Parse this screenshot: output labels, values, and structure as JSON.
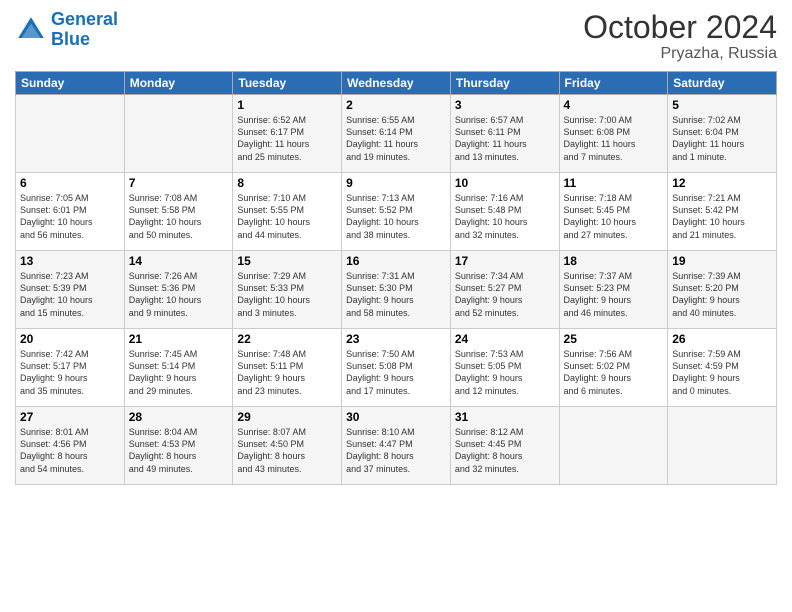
{
  "header": {
    "logo_line1": "General",
    "logo_line2": "Blue",
    "month": "October 2024",
    "location": "Pryazha, Russia"
  },
  "days_of_week": [
    "Sunday",
    "Monday",
    "Tuesday",
    "Wednesday",
    "Thursday",
    "Friday",
    "Saturday"
  ],
  "weeks": [
    [
      {
        "day": "",
        "info": ""
      },
      {
        "day": "",
        "info": ""
      },
      {
        "day": "1",
        "info": "Sunrise: 6:52 AM\nSunset: 6:17 PM\nDaylight: 11 hours\nand 25 minutes."
      },
      {
        "day": "2",
        "info": "Sunrise: 6:55 AM\nSunset: 6:14 PM\nDaylight: 11 hours\nand 19 minutes."
      },
      {
        "day": "3",
        "info": "Sunrise: 6:57 AM\nSunset: 6:11 PM\nDaylight: 11 hours\nand 13 minutes."
      },
      {
        "day": "4",
        "info": "Sunrise: 7:00 AM\nSunset: 6:08 PM\nDaylight: 11 hours\nand 7 minutes."
      },
      {
        "day": "5",
        "info": "Sunrise: 7:02 AM\nSunset: 6:04 PM\nDaylight: 11 hours\nand 1 minute."
      }
    ],
    [
      {
        "day": "6",
        "info": "Sunrise: 7:05 AM\nSunset: 6:01 PM\nDaylight: 10 hours\nand 56 minutes."
      },
      {
        "day": "7",
        "info": "Sunrise: 7:08 AM\nSunset: 5:58 PM\nDaylight: 10 hours\nand 50 minutes."
      },
      {
        "day": "8",
        "info": "Sunrise: 7:10 AM\nSunset: 5:55 PM\nDaylight: 10 hours\nand 44 minutes."
      },
      {
        "day": "9",
        "info": "Sunrise: 7:13 AM\nSunset: 5:52 PM\nDaylight: 10 hours\nand 38 minutes."
      },
      {
        "day": "10",
        "info": "Sunrise: 7:16 AM\nSunset: 5:48 PM\nDaylight: 10 hours\nand 32 minutes."
      },
      {
        "day": "11",
        "info": "Sunrise: 7:18 AM\nSunset: 5:45 PM\nDaylight: 10 hours\nand 27 minutes."
      },
      {
        "day": "12",
        "info": "Sunrise: 7:21 AM\nSunset: 5:42 PM\nDaylight: 10 hours\nand 21 minutes."
      }
    ],
    [
      {
        "day": "13",
        "info": "Sunrise: 7:23 AM\nSunset: 5:39 PM\nDaylight: 10 hours\nand 15 minutes."
      },
      {
        "day": "14",
        "info": "Sunrise: 7:26 AM\nSunset: 5:36 PM\nDaylight: 10 hours\nand 9 minutes."
      },
      {
        "day": "15",
        "info": "Sunrise: 7:29 AM\nSunset: 5:33 PM\nDaylight: 10 hours\nand 3 minutes."
      },
      {
        "day": "16",
        "info": "Sunrise: 7:31 AM\nSunset: 5:30 PM\nDaylight: 9 hours\nand 58 minutes."
      },
      {
        "day": "17",
        "info": "Sunrise: 7:34 AM\nSunset: 5:27 PM\nDaylight: 9 hours\nand 52 minutes."
      },
      {
        "day": "18",
        "info": "Sunrise: 7:37 AM\nSunset: 5:23 PM\nDaylight: 9 hours\nand 46 minutes."
      },
      {
        "day": "19",
        "info": "Sunrise: 7:39 AM\nSunset: 5:20 PM\nDaylight: 9 hours\nand 40 minutes."
      }
    ],
    [
      {
        "day": "20",
        "info": "Sunrise: 7:42 AM\nSunset: 5:17 PM\nDaylight: 9 hours\nand 35 minutes."
      },
      {
        "day": "21",
        "info": "Sunrise: 7:45 AM\nSunset: 5:14 PM\nDaylight: 9 hours\nand 29 minutes."
      },
      {
        "day": "22",
        "info": "Sunrise: 7:48 AM\nSunset: 5:11 PM\nDaylight: 9 hours\nand 23 minutes."
      },
      {
        "day": "23",
        "info": "Sunrise: 7:50 AM\nSunset: 5:08 PM\nDaylight: 9 hours\nand 17 minutes."
      },
      {
        "day": "24",
        "info": "Sunrise: 7:53 AM\nSunset: 5:05 PM\nDaylight: 9 hours\nand 12 minutes."
      },
      {
        "day": "25",
        "info": "Sunrise: 7:56 AM\nSunset: 5:02 PM\nDaylight: 9 hours\nand 6 minutes."
      },
      {
        "day": "26",
        "info": "Sunrise: 7:59 AM\nSunset: 4:59 PM\nDaylight: 9 hours\nand 0 minutes."
      }
    ],
    [
      {
        "day": "27",
        "info": "Sunrise: 8:01 AM\nSunset: 4:56 PM\nDaylight: 8 hours\nand 54 minutes."
      },
      {
        "day": "28",
        "info": "Sunrise: 8:04 AM\nSunset: 4:53 PM\nDaylight: 8 hours\nand 49 minutes."
      },
      {
        "day": "29",
        "info": "Sunrise: 8:07 AM\nSunset: 4:50 PM\nDaylight: 8 hours\nand 43 minutes."
      },
      {
        "day": "30",
        "info": "Sunrise: 8:10 AM\nSunset: 4:47 PM\nDaylight: 8 hours\nand 37 minutes."
      },
      {
        "day": "31",
        "info": "Sunrise: 8:12 AM\nSunset: 4:45 PM\nDaylight: 8 hours\nand 32 minutes."
      },
      {
        "day": "",
        "info": ""
      },
      {
        "day": "",
        "info": ""
      }
    ]
  ]
}
